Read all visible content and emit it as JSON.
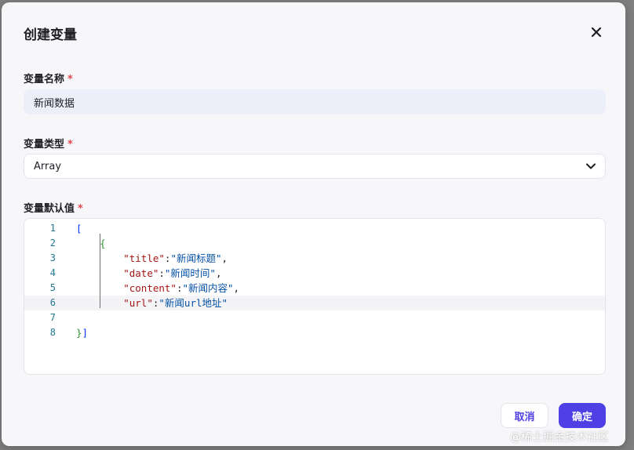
{
  "dialog": {
    "title": "创建变量",
    "close_icon": "close-icon"
  },
  "fields": {
    "name": {
      "label": "变量名称",
      "required": "*",
      "value": "新闻数据"
    },
    "type": {
      "label": "变量类型",
      "required": "*",
      "value": "Array",
      "icon": "chevron-down-icon"
    },
    "default": {
      "label": "变量默认值",
      "required": "*"
    }
  },
  "editor": {
    "line_numbers": [
      "1",
      "2",
      "3",
      "4",
      "5",
      "6",
      "7",
      "8"
    ],
    "lines": [
      {
        "parts": [
          {
            "t": "[",
            "c": "brk1"
          }
        ]
      },
      {
        "parts": [
          {
            "t": "    ",
            "c": "punc"
          },
          {
            "t": "{",
            "c": "brk2"
          }
        ]
      },
      {
        "parts": [
          {
            "t": "        ",
            "c": "punc"
          },
          {
            "t": "\"title\"",
            "c": "str-key"
          },
          {
            "t": ":",
            "c": "punc"
          },
          {
            "t": "\"新闻标题\"",
            "c": "str-val"
          },
          {
            "t": ",",
            "c": "punc"
          }
        ]
      },
      {
        "parts": [
          {
            "t": "        ",
            "c": "punc"
          },
          {
            "t": "\"date\"",
            "c": "str-key"
          },
          {
            "t": ":",
            "c": "punc"
          },
          {
            "t": "\"新闻时间\"",
            "c": "str-val"
          },
          {
            "t": ",",
            "c": "punc"
          }
        ]
      },
      {
        "parts": [
          {
            "t": "        ",
            "c": "punc"
          },
          {
            "t": "\"content\"",
            "c": "str-key"
          },
          {
            "t": ":",
            "c": "punc"
          },
          {
            "t": "\"新闻内容\"",
            "c": "str-val"
          },
          {
            "t": ",",
            "c": "punc"
          }
        ]
      },
      {
        "parts": [
          {
            "t": "        ",
            "c": "punc"
          },
          {
            "t": "\"url\"",
            "c": "str-key"
          },
          {
            "t": ":",
            "c": "punc"
          },
          {
            "t": "\"新闻url地址\"",
            "c": "str-val"
          }
        ]
      },
      {
        "parts": []
      },
      {
        "parts": [
          {
            "t": "}",
            "c": "brk2"
          },
          {
            "t": "]",
            "c": "brk1"
          }
        ]
      }
    ],
    "active_line": "6"
  },
  "footer": {
    "cancel_label": "取消",
    "ok_label": "确定"
  },
  "watermark": "@稀土掘金技术社区",
  "colors": {
    "accent": "#4e40e5",
    "required": "#e5484d"
  }
}
